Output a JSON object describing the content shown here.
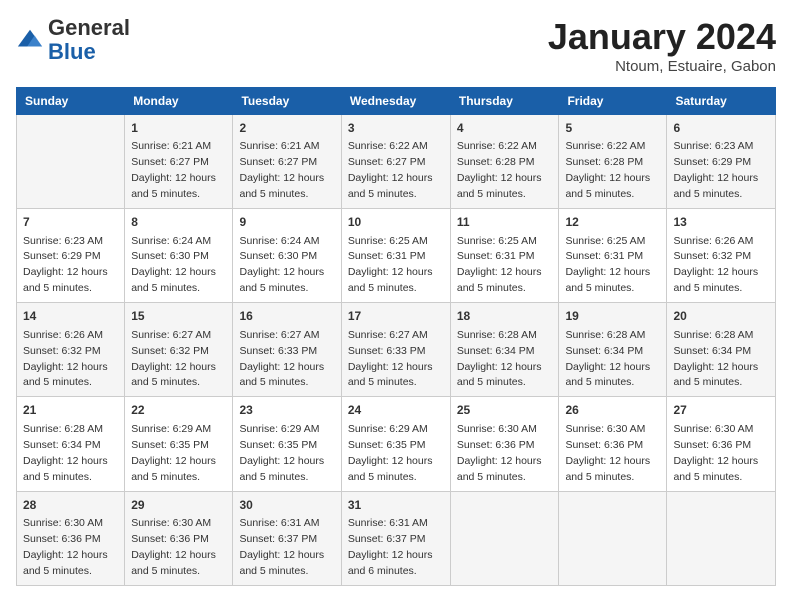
{
  "header": {
    "logo_general": "General",
    "logo_blue": "Blue",
    "month_title": "January 2024",
    "location": "Ntoum, Estuaire, Gabon"
  },
  "columns": [
    "Sunday",
    "Monday",
    "Tuesday",
    "Wednesday",
    "Thursday",
    "Friday",
    "Saturday"
  ],
  "weeks": [
    [
      {
        "day": "",
        "sunrise": "",
        "sunset": "",
        "daylight": ""
      },
      {
        "day": "1",
        "sunrise": "Sunrise: 6:21 AM",
        "sunset": "Sunset: 6:27 PM",
        "daylight": "Daylight: 12 hours and 5 minutes."
      },
      {
        "day": "2",
        "sunrise": "Sunrise: 6:21 AM",
        "sunset": "Sunset: 6:27 PM",
        "daylight": "Daylight: 12 hours and 5 minutes."
      },
      {
        "day": "3",
        "sunrise": "Sunrise: 6:22 AM",
        "sunset": "Sunset: 6:27 PM",
        "daylight": "Daylight: 12 hours and 5 minutes."
      },
      {
        "day": "4",
        "sunrise": "Sunrise: 6:22 AM",
        "sunset": "Sunset: 6:28 PM",
        "daylight": "Daylight: 12 hours and 5 minutes."
      },
      {
        "day": "5",
        "sunrise": "Sunrise: 6:22 AM",
        "sunset": "Sunset: 6:28 PM",
        "daylight": "Daylight: 12 hours and 5 minutes."
      },
      {
        "day": "6",
        "sunrise": "Sunrise: 6:23 AM",
        "sunset": "Sunset: 6:29 PM",
        "daylight": "Daylight: 12 hours and 5 minutes."
      }
    ],
    [
      {
        "day": "7",
        "sunrise": "Sunrise: 6:23 AM",
        "sunset": "Sunset: 6:29 PM",
        "daylight": "Daylight: 12 hours and 5 minutes."
      },
      {
        "day": "8",
        "sunrise": "Sunrise: 6:24 AM",
        "sunset": "Sunset: 6:30 PM",
        "daylight": "Daylight: 12 hours and 5 minutes."
      },
      {
        "day": "9",
        "sunrise": "Sunrise: 6:24 AM",
        "sunset": "Sunset: 6:30 PM",
        "daylight": "Daylight: 12 hours and 5 minutes."
      },
      {
        "day": "10",
        "sunrise": "Sunrise: 6:25 AM",
        "sunset": "Sunset: 6:31 PM",
        "daylight": "Daylight: 12 hours and 5 minutes."
      },
      {
        "day": "11",
        "sunrise": "Sunrise: 6:25 AM",
        "sunset": "Sunset: 6:31 PM",
        "daylight": "Daylight: 12 hours and 5 minutes."
      },
      {
        "day": "12",
        "sunrise": "Sunrise: 6:25 AM",
        "sunset": "Sunset: 6:31 PM",
        "daylight": "Daylight: 12 hours and 5 minutes."
      },
      {
        "day": "13",
        "sunrise": "Sunrise: 6:26 AM",
        "sunset": "Sunset: 6:32 PM",
        "daylight": "Daylight: 12 hours and 5 minutes."
      }
    ],
    [
      {
        "day": "14",
        "sunrise": "Sunrise: 6:26 AM",
        "sunset": "Sunset: 6:32 PM",
        "daylight": "Daylight: 12 hours and 5 minutes."
      },
      {
        "day": "15",
        "sunrise": "Sunrise: 6:27 AM",
        "sunset": "Sunset: 6:32 PM",
        "daylight": "Daylight: 12 hours and 5 minutes."
      },
      {
        "day": "16",
        "sunrise": "Sunrise: 6:27 AM",
        "sunset": "Sunset: 6:33 PM",
        "daylight": "Daylight: 12 hours and 5 minutes."
      },
      {
        "day": "17",
        "sunrise": "Sunrise: 6:27 AM",
        "sunset": "Sunset: 6:33 PM",
        "daylight": "Daylight: 12 hours and 5 minutes."
      },
      {
        "day": "18",
        "sunrise": "Sunrise: 6:28 AM",
        "sunset": "Sunset: 6:34 PM",
        "daylight": "Daylight: 12 hours and 5 minutes."
      },
      {
        "day": "19",
        "sunrise": "Sunrise: 6:28 AM",
        "sunset": "Sunset: 6:34 PM",
        "daylight": "Daylight: 12 hours and 5 minutes."
      },
      {
        "day": "20",
        "sunrise": "Sunrise: 6:28 AM",
        "sunset": "Sunset: 6:34 PM",
        "daylight": "Daylight: 12 hours and 5 minutes."
      }
    ],
    [
      {
        "day": "21",
        "sunrise": "Sunrise: 6:28 AM",
        "sunset": "Sunset: 6:34 PM",
        "daylight": "Daylight: 12 hours and 5 minutes."
      },
      {
        "day": "22",
        "sunrise": "Sunrise: 6:29 AM",
        "sunset": "Sunset: 6:35 PM",
        "daylight": "Daylight: 12 hours and 5 minutes."
      },
      {
        "day": "23",
        "sunrise": "Sunrise: 6:29 AM",
        "sunset": "Sunset: 6:35 PM",
        "daylight": "Daylight: 12 hours and 5 minutes."
      },
      {
        "day": "24",
        "sunrise": "Sunrise: 6:29 AM",
        "sunset": "Sunset: 6:35 PM",
        "daylight": "Daylight: 12 hours and 5 minutes."
      },
      {
        "day": "25",
        "sunrise": "Sunrise: 6:30 AM",
        "sunset": "Sunset: 6:36 PM",
        "daylight": "Daylight: 12 hours and 5 minutes."
      },
      {
        "day": "26",
        "sunrise": "Sunrise: 6:30 AM",
        "sunset": "Sunset: 6:36 PM",
        "daylight": "Daylight: 12 hours and 5 minutes."
      },
      {
        "day": "27",
        "sunrise": "Sunrise: 6:30 AM",
        "sunset": "Sunset: 6:36 PM",
        "daylight": "Daylight: 12 hours and 5 minutes."
      }
    ],
    [
      {
        "day": "28",
        "sunrise": "Sunrise: 6:30 AM",
        "sunset": "Sunset: 6:36 PM",
        "daylight": "Daylight: 12 hours and 5 minutes."
      },
      {
        "day": "29",
        "sunrise": "Sunrise: 6:30 AM",
        "sunset": "Sunset: 6:36 PM",
        "daylight": "Daylight: 12 hours and 5 minutes."
      },
      {
        "day": "30",
        "sunrise": "Sunrise: 6:31 AM",
        "sunset": "Sunset: 6:37 PM",
        "daylight": "Daylight: 12 hours and 5 minutes."
      },
      {
        "day": "31",
        "sunrise": "Sunrise: 6:31 AM",
        "sunset": "Sunset: 6:37 PM",
        "daylight": "Daylight: 12 hours and 6 minutes."
      },
      {
        "day": "",
        "sunrise": "",
        "sunset": "",
        "daylight": ""
      },
      {
        "day": "",
        "sunrise": "",
        "sunset": "",
        "daylight": ""
      },
      {
        "day": "",
        "sunrise": "",
        "sunset": "",
        "daylight": ""
      }
    ]
  ]
}
